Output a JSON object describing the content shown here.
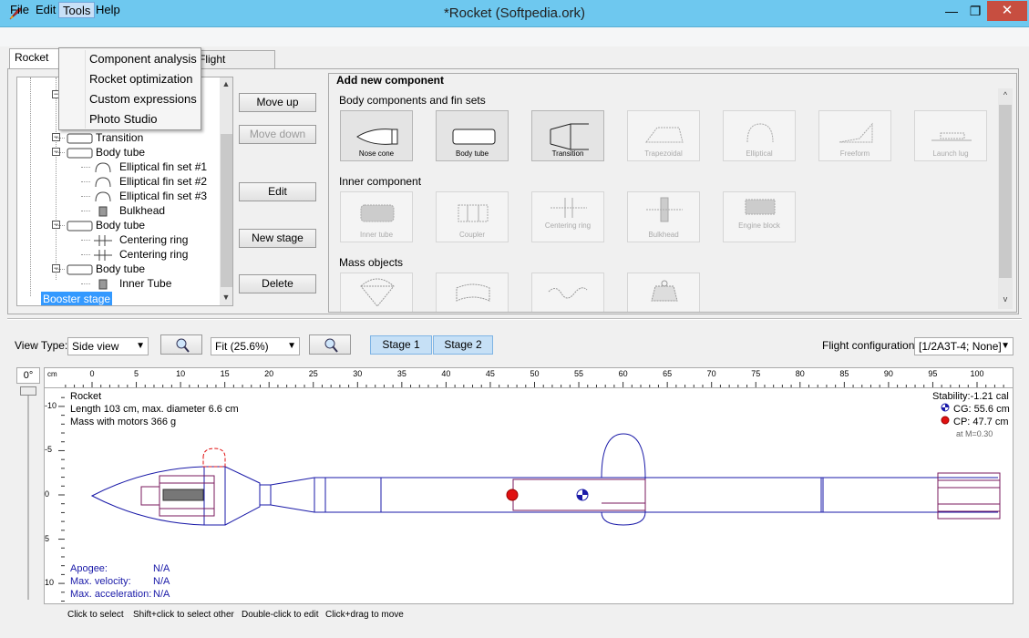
{
  "window": {
    "title": "*Rocket (Softpedia.ork)",
    "min": "—",
    "max": "❐",
    "close": "✕"
  },
  "menu": {
    "file": "File",
    "edit": "Edit",
    "tools": "Tools",
    "help": "Help"
  },
  "tools_menu": [
    "Component analysis",
    "Rocket optimization",
    "Custom expressions",
    "Photo Studio"
  ],
  "tabs": {
    "design": "Rocket de",
    "sims": "Flight simulations"
  },
  "tree": {
    "items": [
      {
        "label": "Transition",
        "indent": 1
      },
      {
        "label": "Body tube",
        "indent": 1
      },
      {
        "label": "Elliptical fin set #1",
        "indent": 2
      },
      {
        "label": "Elliptical fin set #2",
        "indent": 2
      },
      {
        "label": "Elliptical fin set #3",
        "indent": 2
      },
      {
        "label": "Bulkhead",
        "indent": 2
      },
      {
        "label": "Body tube",
        "indent": 1
      },
      {
        "label": "Centering ring",
        "indent": 2
      },
      {
        "label": "Centering ring",
        "indent": 2
      },
      {
        "label": "Body tube",
        "indent": 1
      },
      {
        "label": "Inner Tube",
        "indent": 2
      }
    ],
    "selected": "Booster stage"
  },
  "side_buttons": {
    "move_up": "Move up",
    "move_down": "Move down",
    "edit": "Edit",
    "new_stage": "New stage",
    "delete": "Delete"
  },
  "add_component": {
    "title": "Add new component",
    "body_section": "Body components and fin sets",
    "body": [
      "Nose cone",
      "Body tube",
      "Transition",
      "Trapezoidal",
      "Elliptical",
      "Freeform",
      "Launch lug"
    ],
    "inner_section": "Inner component",
    "inner": [
      "Inner tube",
      "Coupler",
      "Centering ring",
      "Bulkhead",
      "Engine block"
    ],
    "mass_section": "Mass objects"
  },
  "view": {
    "type_label": "View Type:",
    "type_value": "Side view",
    "zoom_value": "Fit (25.6%)",
    "stage1": "Stage 1",
    "stage2": "Stage 2",
    "flight_config_label": "Flight configuration:",
    "flight_config_value": "[1/2A3T-4; None]",
    "angle": "0°"
  },
  "canvas": {
    "rocket_name": "Rocket",
    "length": "Length 103 cm, max. diameter 6.6 cm",
    "mass": "Mass with motors 366 g",
    "stability": "Stability:-1.21 cal",
    "cg": "CG: 55.6 cm",
    "cp": "CP: 47.7 cm",
    "mach": "at M=0.30",
    "apogee_label": "Apogee:",
    "apogee_value": "N/A",
    "vel_label": "Max. velocity:",
    "vel_value": "N/A",
    "acc_label": "Max. acceleration:",
    "acc_value": "N/A",
    "ruler_unit": "cm",
    "ruler_ticks": [
      "0",
      "5",
      "10",
      "15",
      "20",
      "25",
      "30",
      "35",
      "40",
      "45",
      "50",
      "55",
      "60",
      "65",
      "70",
      "75",
      "80",
      "85",
      "90",
      "95",
      "100"
    ],
    "vruler_ticks": [
      "-10",
      "-5",
      "0",
      "5",
      "10"
    ]
  },
  "hints": [
    "Click to select",
    "Shift+click to select other",
    "Double-click to edit",
    "Click+drag to move"
  ],
  "colors": {
    "titlebar": "#6ec8ef",
    "rocket_line": "#1a1aa8",
    "inner_line": "#7a1a5e",
    "cp_red": "#e01010",
    "selection": "#3399ff"
  }
}
